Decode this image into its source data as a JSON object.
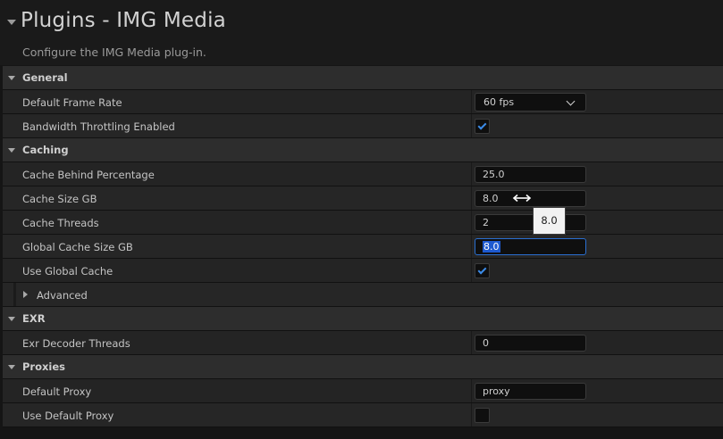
{
  "header": {
    "title": "Plugins - IMG Media",
    "subtitle": "Configure the IMG Media plug-in."
  },
  "sections": {
    "general": "General",
    "caching": "Caching",
    "exr": "EXR",
    "proxies": "Proxies"
  },
  "general": {
    "frame_rate_label": "Default Frame Rate",
    "frame_rate_value": "60 fps",
    "bandwidth_label": "Bandwidth Throttling Enabled",
    "bandwidth_checked": true
  },
  "caching": {
    "behind_label": "Cache Behind Percentage",
    "behind_value": "25.0",
    "size_label": "Cache Size GB",
    "size_value": "8.0",
    "threads_label": "Cache Threads",
    "threads_value": "2",
    "global_size_label": "Global Cache Size GB",
    "global_size_value": "8.0",
    "use_global_label": "Use Global Cache",
    "use_global_checked": true,
    "advanced_label": "Advanced"
  },
  "exr": {
    "threads_label": "Exr Decoder Threads",
    "threads_value": "0"
  },
  "proxies": {
    "default_label": "Default Proxy",
    "default_value": "proxy",
    "use_label": "Use Default Proxy",
    "use_checked": false
  },
  "tooltip": {
    "value": "8.0"
  },
  "colors": {
    "accent": "#2a6fd1",
    "check": "#3b8be8",
    "selection": "#1e5ad0"
  }
}
